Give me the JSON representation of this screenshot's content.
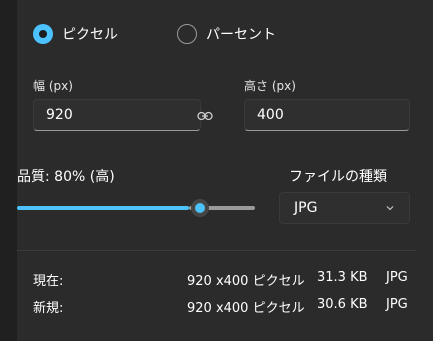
{
  "size_mode": {
    "options": [
      {
        "label": "ピクセル",
        "selected": true
      },
      {
        "label": "パーセント",
        "selected": false
      }
    ]
  },
  "width": {
    "label": "幅 (px)",
    "value": "920"
  },
  "height": {
    "label": "高さ (px)",
    "value": "400"
  },
  "aspect_lock_icon": "link-icon",
  "quality": {
    "label": "品質: 80% (高)",
    "value_percent": 80
  },
  "file_type": {
    "label": "ファイルの種類",
    "selected": "JPG"
  },
  "info": {
    "current": {
      "label": "現在:",
      "dimensions": "920 x400 ピクセル",
      "size": "31.3 KB",
      "format": "JPG"
    },
    "new": {
      "label": "新規:",
      "dimensions": "920 x400 ピクセル",
      "size": "30.6 KB",
      "format": "JPG"
    }
  },
  "colors": {
    "accent": "#4cc2ff",
    "background": "#2b2b2b"
  }
}
